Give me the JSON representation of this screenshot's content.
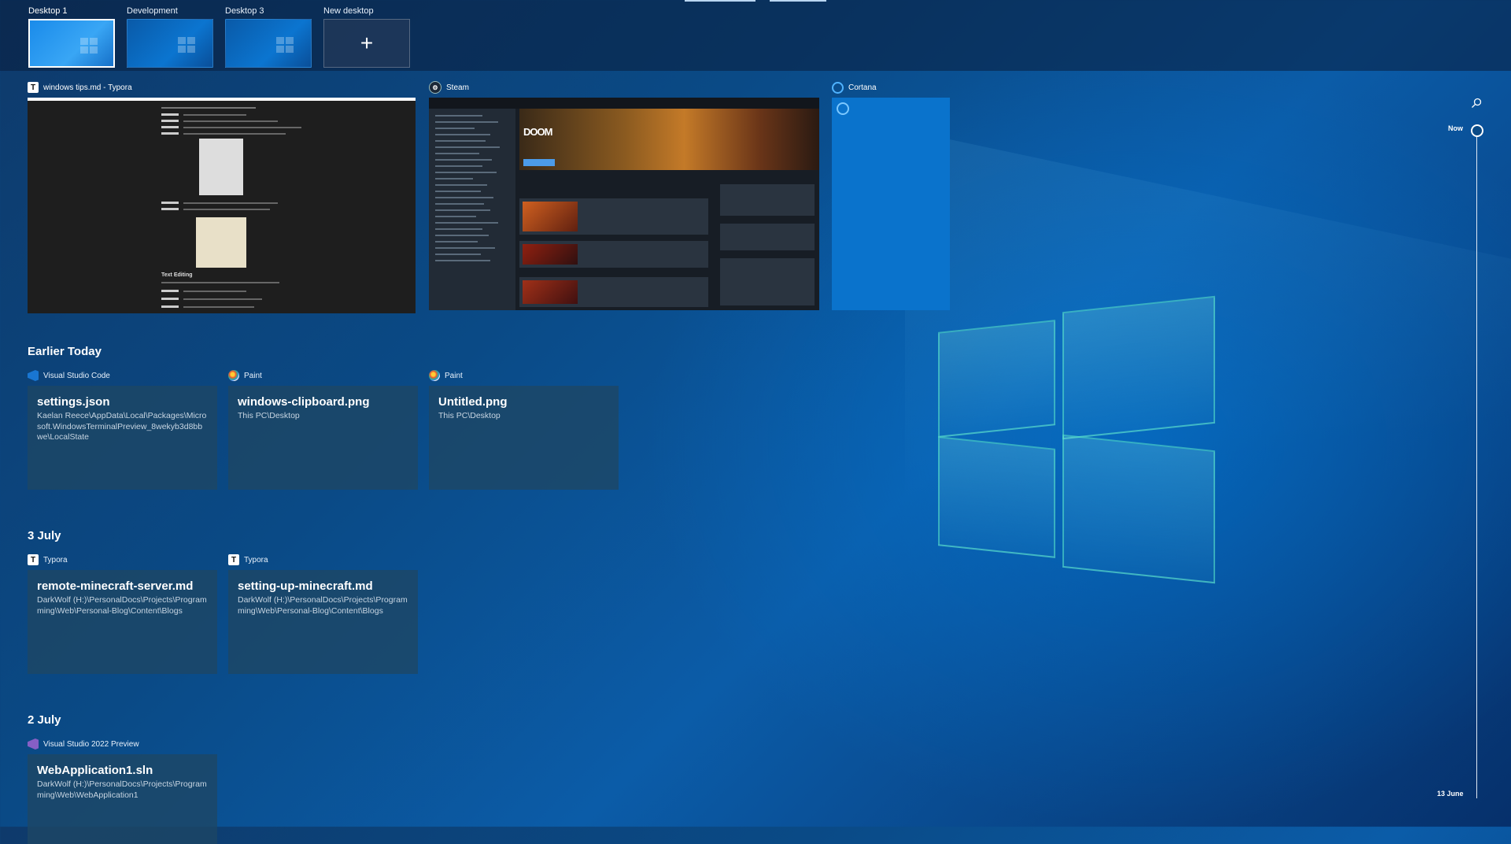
{
  "desktops": [
    {
      "label": "Desktop 1",
      "active": true
    },
    {
      "label": "Development",
      "active": false
    },
    {
      "label": "Desktop 3",
      "active": false
    },
    {
      "label": "New desktop",
      "glyph": "+"
    }
  ],
  "windows": [
    {
      "app": "windows tips.md - Typora",
      "icon": "T"
    },
    {
      "app": "Steam"
    },
    {
      "app": "Cortana"
    }
  ],
  "steam_preview": {
    "game_logo_text": "DOOM"
  },
  "typora_preview": {
    "heading": "Text Editing"
  },
  "sections": [
    {
      "title": "Earlier Today",
      "cards": [
        {
          "app": "Visual Studio Code",
          "title": "settings.json",
          "path": "Kaelan Reece\\AppData\\Local\\Packages\\Microsoft.WindowsTerminalPreview_8wekyb3d8bbwe\\LocalState"
        },
        {
          "app": "Paint",
          "title": "windows-clipboard.png",
          "path": "This PC\\Desktop"
        },
        {
          "app": "Paint",
          "title": "Untitled.png",
          "path": "This PC\\Desktop"
        }
      ]
    },
    {
      "title": "3 July",
      "cards": [
        {
          "app": "Typora",
          "icon": "T",
          "title": "remote-minecraft-server.md",
          "path": "DarkWolf (H:)\\PersonalDocs\\Projects\\Programming\\Web\\Personal-Blog\\Content\\Blogs"
        },
        {
          "app": "Typora",
          "icon": "T",
          "title": "setting-up-minecraft.md",
          "path": "DarkWolf (H:)\\PersonalDocs\\Projects\\Programming\\Web\\Personal-Blog\\Content\\Blogs"
        }
      ]
    },
    {
      "title": "2 July",
      "cards": [
        {
          "app": "Visual Studio 2022 Preview",
          "title": "WebApplication1.sln",
          "path": "DarkWolf (H:)\\PersonalDocs\\Projects\\Programming\\Web\\WebApplication1"
        }
      ]
    }
  ],
  "timeline": {
    "now_label": "Now",
    "end_label": "13 June"
  },
  "colors": {
    "accent": "#0078d7",
    "card_bg": "#1e4664",
    "cortana": "#0a73cc"
  }
}
